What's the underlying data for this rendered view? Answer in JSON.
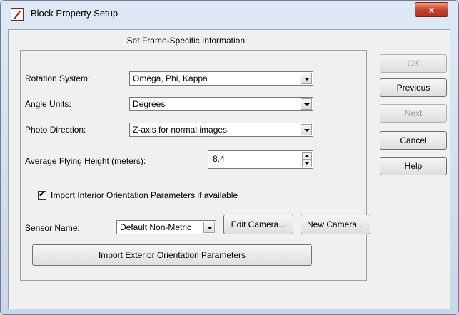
{
  "window": {
    "title": "Block Property Setup",
    "close_label": "x"
  },
  "heading": "Set Frame-Specific Information:",
  "form": {
    "rotation_label": "Rotation System:",
    "rotation_value": "Omega, Phi, Kappa",
    "angle_label": "Angle Units:",
    "angle_value": "Degrees",
    "photo_label": "Photo Direction:",
    "photo_value": "Z-axis for normal images",
    "height_label": "Average Flying Height (meters):",
    "height_value": "8.4",
    "import_io_label": "Import Interior Orientation Parameters if available",
    "import_io_checked": true,
    "sensor_label": "Sensor Name:",
    "sensor_value": "Default Non-Metric",
    "edit_camera": "Edit Camera...",
    "new_camera": "New Camera...",
    "import_eo": "Import Exterior Orientation Parameters"
  },
  "buttons": {
    "ok": "OK",
    "previous": "Previous",
    "next": "Next",
    "cancel": "Cancel",
    "help": "Help"
  },
  "colors": {
    "close": "#c7412a",
    "titlebar": "#dfe9f5",
    "dialog": "#f0f0f0"
  }
}
